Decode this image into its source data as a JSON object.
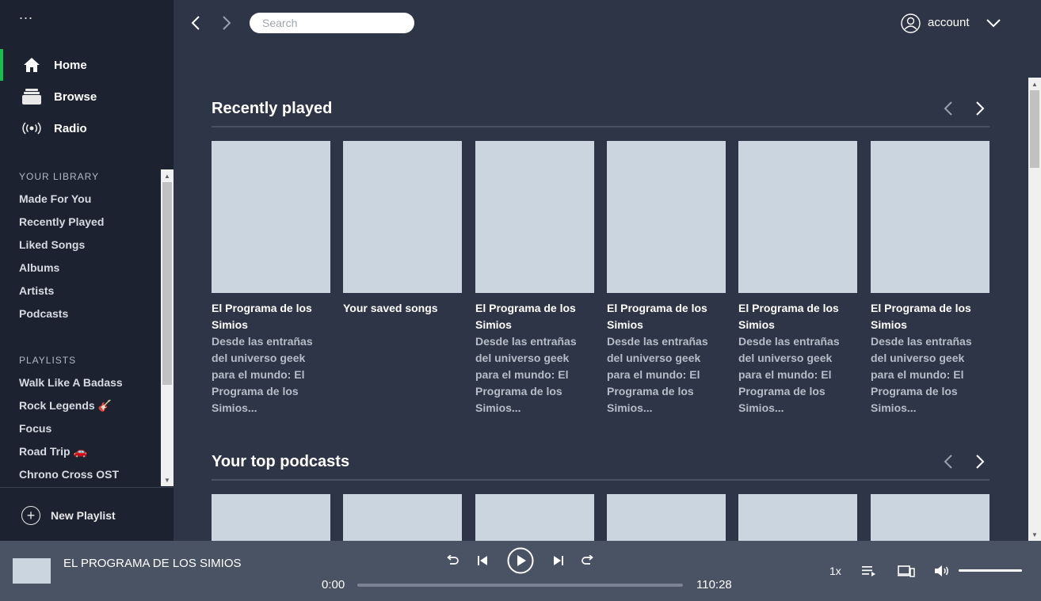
{
  "sidebar": {
    "menu_glyph": "...",
    "nav": [
      {
        "label": "Home",
        "icon": "home-icon",
        "active": true
      },
      {
        "label": "Browse",
        "icon": "browse-icon",
        "active": false
      },
      {
        "label": "Radio",
        "icon": "radio-icon",
        "active": false
      }
    ],
    "library_header": "YOUR LIBRARY",
    "library": [
      "Made For You",
      "Recently Played",
      "Liked Songs",
      "Albums",
      "Artists",
      "Podcasts"
    ],
    "playlists_header": "PLAYLISTS",
    "playlists": [
      "Walk Like A Badass",
      "Rock Legends 🎸",
      "Focus",
      "Road Trip 🚗",
      "Chrono Cross OST"
    ],
    "new_playlist": "New Playlist"
  },
  "topbar": {
    "search_placeholder": "Search",
    "account_label": "account"
  },
  "recently_played": {
    "title": "Recently played",
    "cards": [
      {
        "title": "El Programa de los Simios",
        "desc": "Desde las entrañas del universo geek para el mundo: El Programa de los Simios..."
      },
      {
        "title": "Your saved songs",
        "desc": ""
      },
      {
        "title": "El Programa de los Simios",
        "desc": "Desde las entrañas del universo geek para el mundo: El Programa de los Simios..."
      },
      {
        "title": "El Programa de los Simios",
        "desc": "Desde las entrañas del universo geek para el mundo: El Programa de los Simios..."
      },
      {
        "title": "El Programa de los Simios",
        "desc": "Desde las entrañas del universo geek para el mundo: El Programa de los Simios..."
      },
      {
        "title": "El Programa de los Simios",
        "desc": "Desde las entrañas del universo geek para el mundo: El Programa de los Simios..."
      }
    ]
  },
  "top_podcasts": {
    "title": "Your top podcasts",
    "card_count_visible": 6
  },
  "player": {
    "now_playing": "EL PROGRAMA DE LOS SIMIOS",
    "current_time": "0:00",
    "total_time": "110:28",
    "progress": 0,
    "speed": "1x",
    "volume": 1.0
  },
  "colors": {
    "accent": "#1db954",
    "sidebar_bg": "#1c222f",
    "main_bg": "#2e3546",
    "player_bg": "#4a5363",
    "placeholder_art": "#cbd5e0"
  }
}
